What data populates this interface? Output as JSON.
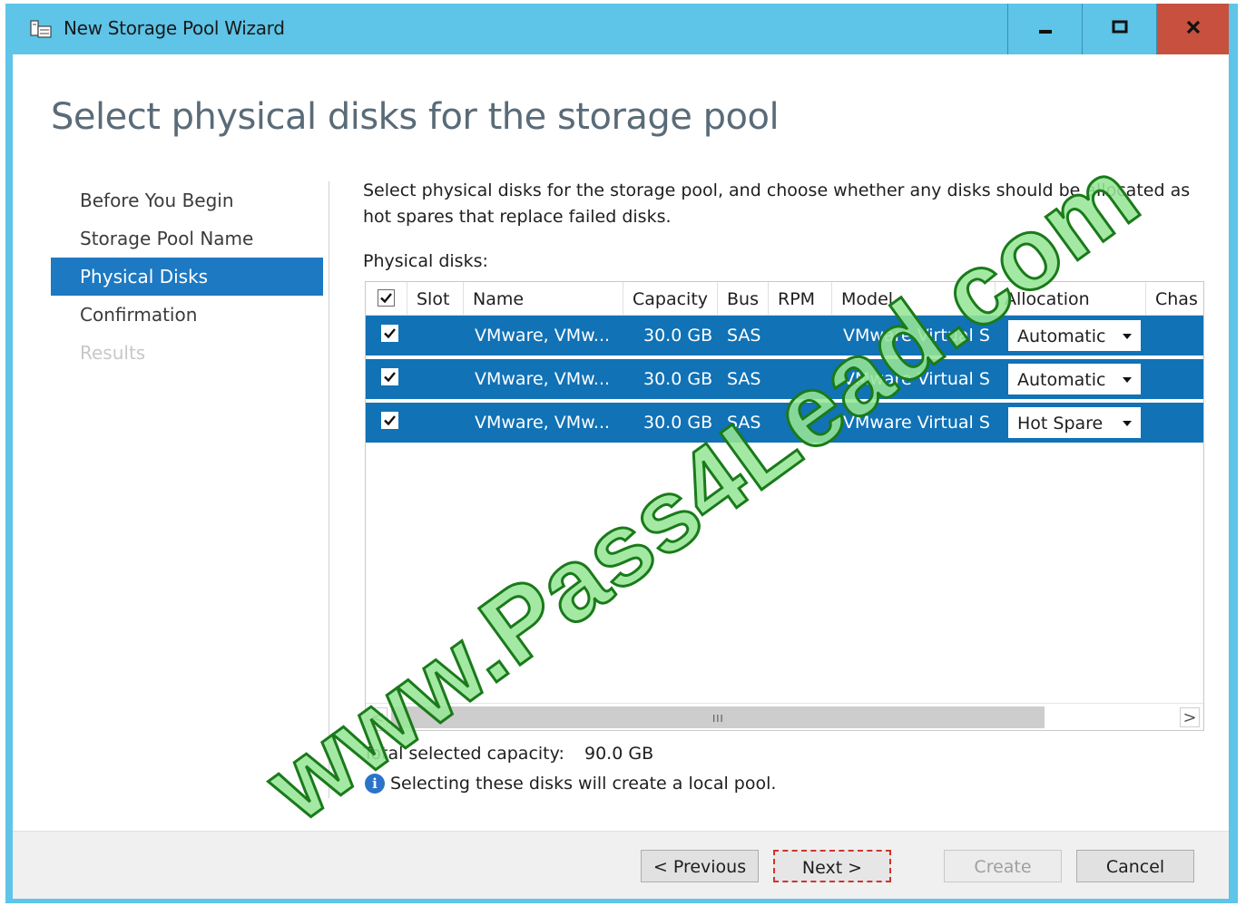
{
  "window": {
    "title": "New Storage Pool Wizard",
    "minimize_glyph": "–",
    "maximize_glyph": "□",
    "close_glyph": "X"
  },
  "page": {
    "heading": "Select physical disks for the storage pool"
  },
  "nav": {
    "items": [
      {
        "label": "Before You Begin",
        "state": "normal"
      },
      {
        "label": "Storage Pool Name",
        "state": "normal"
      },
      {
        "label": "Physical Disks",
        "state": "active"
      },
      {
        "label": "Confirmation",
        "state": "normal"
      },
      {
        "label": "Results",
        "state": "disabled"
      }
    ]
  },
  "content": {
    "description": "Select physical disks for the storage pool, and choose whether any disks should be allocated as hot spares that replace failed disks.",
    "physical_disks_label": "Physical disks:",
    "columns": [
      "Slot",
      "Name",
      "Capacity",
      "Bus",
      "RPM",
      "Model",
      "Allocation",
      "Chas"
    ],
    "rows": [
      {
        "checked": true,
        "slot": "",
        "name": "VMware, VMw...",
        "capacity": "30.0 GB",
        "bus": "SAS",
        "rpm": "",
        "model": "VMware Virtual S",
        "allocation": "Automatic"
      },
      {
        "checked": true,
        "slot": "",
        "name": "VMware, VMw...",
        "capacity": "30.0 GB",
        "bus": "SAS",
        "rpm": "",
        "model": "VMware Virtual S",
        "allocation": "Automatic"
      },
      {
        "checked": true,
        "slot": "",
        "name": "VMware, VMw...",
        "capacity": "30.0 GB",
        "bus": "SAS",
        "rpm": "",
        "model": "VMware Virtual S",
        "allocation": "Hot Spare"
      }
    ],
    "scroll_left_glyph": "<",
    "scroll_right_glyph": ">",
    "scroll_grip": "III",
    "total_capacity_label": "Total selected capacity:",
    "total_capacity_value": "90.0 GB",
    "info_icon_glyph": "i",
    "info_message": "Selecting these disks will create a local pool."
  },
  "footer": {
    "previous": "< Previous",
    "next": "Next >",
    "create": "Create",
    "cancel": "Cancel"
  },
  "watermark": "www.Pass4Lead.com",
  "colors": {
    "titlebar": "#5ec4e8",
    "close_button": "#c7503f",
    "selection": "#1172b6",
    "nav_active": "#1d79c2",
    "focus_border": "#d0342c"
  }
}
